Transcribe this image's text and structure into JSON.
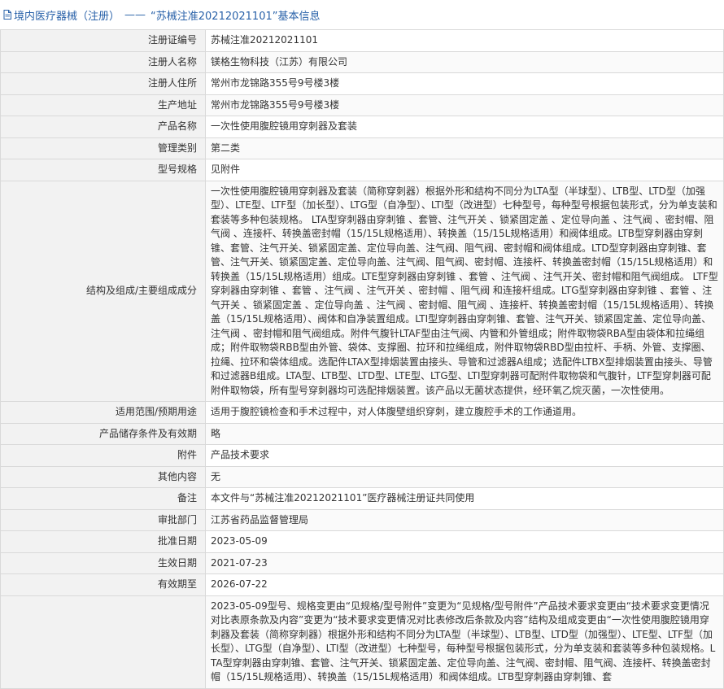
{
  "header": {
    "icon": "document-icon",
    "prefix": "境内医疗器械（注册）",
    "separator": "——",
    "title": "“苏械注准20212021101”基本信息"
  },
  "rows": [
    {
      "label": "注册证编号",
      "value": "苏械注准20212021101"
    },
    {
      "label": "注册人名称",
      "value": "镁格生物科技（江苏）有限公司"
    },
    {
      "label": "注册人住所",
      "value": "常州市龙锦路355号9号楼3楼"
    },
    {
      "label": "生产地址",
      "value": "常州市龙锦路355号9号楼3楼"
    },
    {
      "label": "产品名称",
      "value": "一次性使用腹腔镜用穿刺器及套装"
    },
    {
      "label": "管理类别",
      "value": "第二类"
    },
    {
      "label": "型号规格",
      "value": "见附件"
    },
    {
      "label": "结构及组成/主要组成成分",
      "value": "一次性使用腹腔镜用穿刺器及套装（简称穿刺器）根据外形和结构不同分为LTA型（半球型）、LTB型、LTD型（加强型）、LTE型、LTF型（加长型）、LTG型（自净型）、LTI型（改进型）七种型号，每种型号根据包装形式，分为单支装和套装等多种包装规格。 LTA型穿刺器由穿刺锥 、套管、注气开关 、锁紧固定盖 、定位导向盖 、注气阀 、密封帽、阻气阀 、连接杆、转换盖密封帽（15/15L规格适用）、转换盖（15/15L规格适用）和阀体组成。LTB型穿刺器由穿刺锥、套管、注气开关、锁紧固定盖、定位导向盖、注气阀、阻气阀、密封帽和阀体组成。LTD型穿刺器由穿刺锥、套管、注气开关、锁紧固定盖、定位导向盖、注气阀、阻气阀、密封帽、连接杆、转换盖密封帽（15/15L规格适用）和转换盖（15/15L规格适用）组成。LTE型穿刺器由穿刺锥 、套管 、注气阀 、注气开关、密封帽和阻气阀组成。 LTF型穿刺器由穿刺锥 、套管 、注气阀 、注气开关 、密封帽 、阻气阀 和连接杆组成。LTG型穿刺器由穿刺锥 、套管 、注气开关 、锁紧固定盖 、定位导向盖 、注气阀 、密封帽、阻气阀 、连接杆、转换盖密封帽（15/15L规格适用）、转换盖（15/15L规格适用）、阀体和自净装置组成。LTI型穿刺器由穿刺锥、套管、注气开关、锁紧固定盖、定位导向盖、注气阀 、密封帽和阻气阀组成。附件气腹针LTAF型由注气阀、内管和外管组成；附件取物袋RBA型由袋体和拉绳组成；附件取物袋RBB型由外管、袋体、支撑圈、拉环和拉绳组成，附件取物袋RBD型由拉杆、手柄、外管、支撑圈、拉绳、拉环和袋体组成。选配件LTAX型排烟装置由接头、导管和过滤器A组成；选配件LTBX型排烟装置由接头、导管和过滤器B组成。LTA型、LTB型、LTD型、LTE型、LTG型、LTI型穿刺器可配附件取物袋和气腹针，LTF型穿刺器可配附件取物袋，所有型号穿刺器均可选配排烟装置。该产品以无菌状态提供，经环氧乙烷灭菌，一次性使用。"
    },
    {
      "label": "适用范围/预期用途",
      "value": "适用于腹腔镜检查和手术过程中，对人体腹壁组织穿刺，建立腹腔手术的工作通道用。"
    },
    {
      "label": "产品储存条件及有效期",
      "value": "略"
    },
    {
      "label": "附件",
      "value": "产品技术要求"
    },
    {
      "label": "其他内容",
      "value": "无"
    },
    {
      "label": "备注",
      "value": "本文件与“苏械注准20212021101”医疗器械注册证共同使用"
    },
    {
      "label": "审批部门",
      "value": "江苏省药品监督管理局"
    },
    {
      "label": "批准日期",
      "value": "2023-05-09"
    },
    {
      "label": "生效日期",
      "value": "2021-07-23"
    },
    {
      "label": "有效期至",
      "value": "2026-07-22"
    },
    {
      "label": "",
      "value": "2023-05-09型号、规格变更由“见规格/型号附件”变更为“见规格/型号附件”产品技术要求变更由“技术要求变更情况对比表原条款及内容”变更为“技术要求变更情况对比表修改后条款及内容”结构及组成变更由“一次性使用腹腔镜用穿刺器及套装（简称穿刺器）根据外形和结构不同分为LTA型（半球型）、LTB型、LTD型（加强型）、LTE型、LTF型（加长型）、LTG型（自净型）、LTI型（改进型）七种型号，每种型号根据包装形式，分为单支装和套装等多种包装规格。LTA型穿刺器由穿刺锥、套管、注气开关、锁紧固定盖、定位导向盖、注气阀、密封帽、阻气阀、连接杆、转换盖密封帽（15/15L规格适用）、转换盖（15/15L规格适用）和阀体组成。LTB型穿刺器由穿刺锥、套"
    }
  ]
}
